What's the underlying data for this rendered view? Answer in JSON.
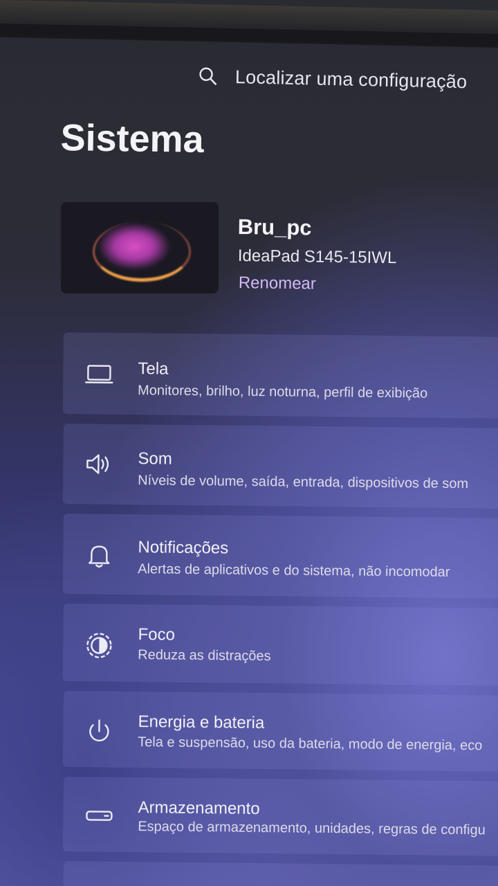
{
  "search": {
    "placeholder": "Localizar uma configuração",
    "icon": "search-icon"
  },
  "page": {
    "title": "Sistema"
  },
  "device": {
    "name": "Bru_pc",
    "model": "IdeaPad S145-15IWL",
    "rename_label": "Renomear"
  },
  "settings": [
    {
      "name": "Tela",
      "description": "Monitores, brilho, luz noturna, perfil de exibição",
      "icon": "monitor-icon"
    },
    {
      "name": "Som",
      "description": "Níveis de volume, saída, entrada, dispositivos de som",
      "icon": "speaker-icon"
    },
    {
      "name": "Notificações",
      "description": "Alertas de aplicativos e do sistema, não incomodar",
      "icon": "bell-icon"
    },
    {
      "name": "Foco",
      "description": "Reduza as distrações",
      "icon": "focus-icon"
    },
    {
      "name": "Energia e bateria",
      "description": "Tela e suspensão, uso da bateria, modo de energia, eco",
      "icon": "power-icon"
    },
    {
      "name": "Armazenamento",
      "description": "Espaço de armazenamento, unidades, regras de configu",
      "icon": "storage-icon"
    }
  ],
  "colors": {
    "accent": "#d3b9f5",
    "background": "#2c2c38"
  }
}
